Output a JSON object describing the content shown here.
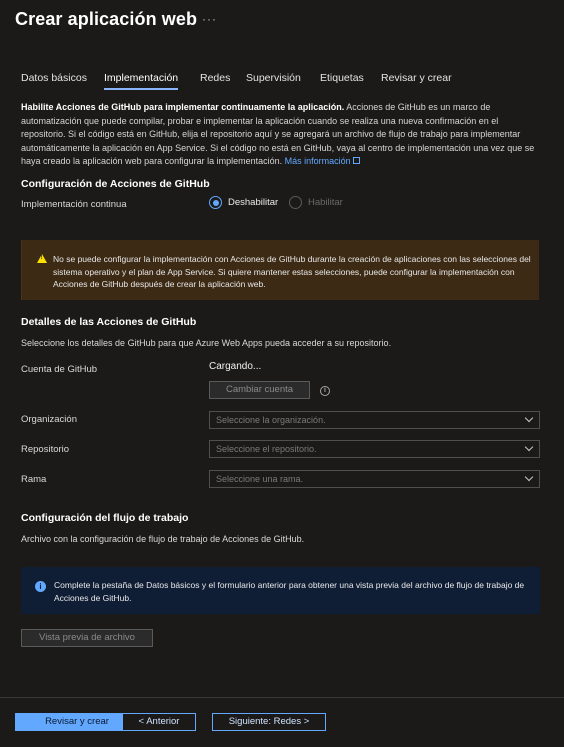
{
  "header": {
    "title": "Crear aplicación web",
    "more": "···"
  },
  "tabs": [
    {
      "label": "Datos básicos"
    },
    {
      "label": "Implementación"
    },
    {
      "label": "Redes"
    },
    {
      "label": "Supervisión"
    },
    {
      "label": "Etiquetas"
    },
    {
      "label": "Revisar y crear"
    }
  ],
  "intro": {
    "bold": "Habilite Acciones de GitHub para implementar continuamente la aplicación.",
    "text": " Acciones de GitHub es un marco de automatización que puede compilar, probar e implementar la aplicación cuando se realiza una nueva confirmación en el repositorio. Si el código está en GitHub, elija el repositorio aquí y se agregará un archivo de flujo de trabajo para implementar automáticamente la aplicación en App Service. Si el código no está en GitHub, vaya al centro de implementación una vez que se haya creado la aplicación web para configurar la implementación. ",
    "link": "Más información"
  },
  "actions_config": {
    "heading": "Configuración de Acciones de GitHub",
    "continuous_label": "Implementación continua",
    "option_disable": "Deshabilitar",
    "option_enable": "Habilitar",
    "selected": "Deshabilitar"
  },
  "warning": {
    "text": "No se puede configurar la implementación con Acciones de GitHub durante la creación de aplicaciones con las selecciones del sistema operativo y el plan de App Service. Si quiere mantener estas selecciones, puede configurar la implementación con Acciones de GitHub después de crear la aplicación web."
  },
  "details": {
    "heading": "Detalles de las Acciones de GitHub",
    "description": "Seleccione los detalles de GitHub para que Azure Web Apps pueda acceder a su repositorio.",
    "account_label": "Cuenta de GitHub",
    "account_value": "Cargando...",
    "change_account": "Cambiar cuenta",
    "org_label": "Organización",
    "org_placeholder": "Seleccione la organización.",
    "repo_label": "Repositorio",
    "repo_placeholder": "Seleccione el repositorio.",
    "branch_label": "Rama",
    "branch_placeholder": "Seleccione una rama."
  },
  "workflow": {
    "heading": "Configuración del flujo de trabajo",
    "description": "Archivo con la configuración de flujo de trabajo de Acciones de GitHub.",
    "info": "Complete la pestaña de Datos básicos y el formulario anterior para obtener una vista previa del archivo de flujo de trabajo de Acciones de GitHub.",
    "preview_button": "Vista previa de archivo"
  },
  "footer": {
    "review": "Revisar y crear",
    "previous": "< Anterior",
    "next": "Siguiente: Redes >"
  }
}
